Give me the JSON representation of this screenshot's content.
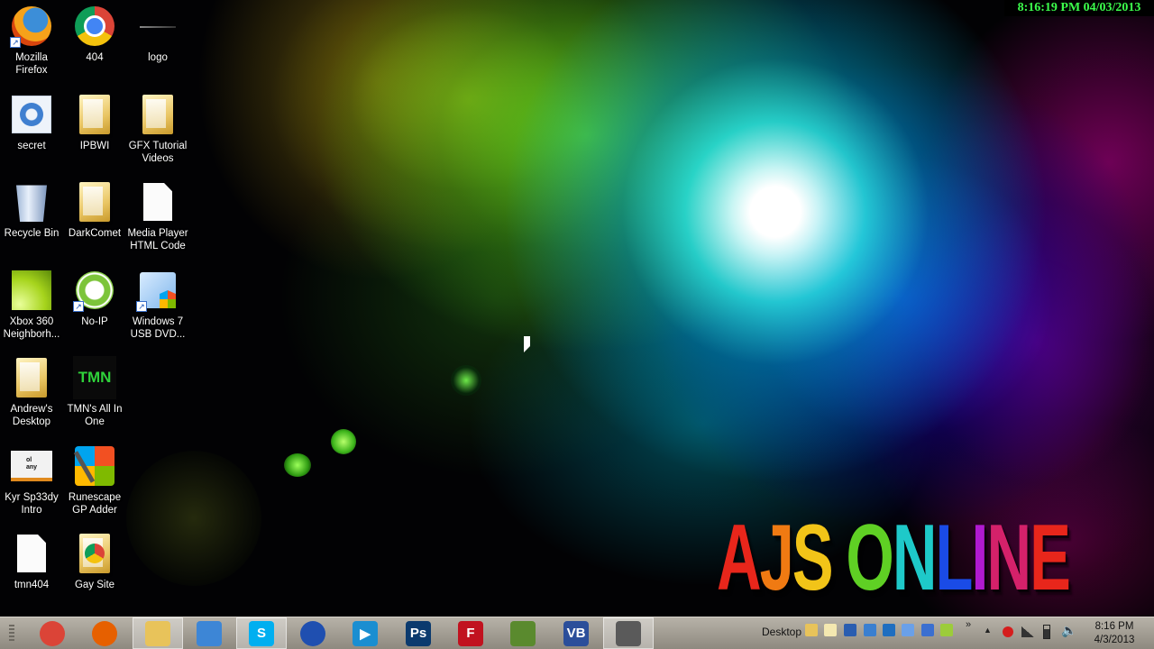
{
  "desktop_icons": [
    {
      "label": "Mozilla\nFirefox",
      "icon": "firefox-icon"
    },
    {
      "label": "404",
      "icon": "chrome-icon"
    },
    {
      "label": "logo",
      "icon": "logo-thumbnail-icon"
    },
    {
      "label": "secret",
      "icon": "settings-gear-icon"
    },
    {
      "label": "IPBWI",
      "icon": "folder-icon"
    },
    {
      "label": "GFX Tutorial\nVideos",
      "icon": "folder-icon"
    },
    {
      "label": "Recycle Bin",
      "icon": "recycle-bin-icon"
    },
    {
      "label": "DarkComet",
      "icon": "folder-icon"
    },
    {
      "label": "Media Player\nHTML Code",
      "icon": "document-icon"
    },
    {
      "label": "Xbox 360\nNeighborh...",
      "icon": "xbox-icon"
    },
    {
      "label": "No-IP",
      "icon": "noip-icon"
    },
    {
      "label": "Windows 7\nUSB DVD...",
      "icon": "windows-usb-icon"
    },
    {
      "label": "Andrew's\nDesktop",
      "icon": "folder-icon"
    },
    {
      "label": "TMN's All In\nOne",
      "icon": "tmn-icon"
    },
    {
      "label": "Kyr Sp33dy\nIntro",
      "icon": "video-thumbnail-icon"
    },
    {
      "label": "Runescape\nGP Adder",
      "icon": "runescape-tool-icon"
    },
    {
      "label": "tmn404",
      "icon": "document-icon"
    },
    {
      "label": "Gay Site",
      "icon": "chrome-folder-icon"
    }
  ],
  "tmn_logo_text": "TMN",
  "kyr_thumb_text": "ol\nany",
  "overlay_clock": "8:16:19 PM 04/03/2013",
  "brand_text": [
    "A",
    "J",
    "S",
    " ",
    "O",
    "N",
    "L",
    "I",
    "N",
    "E"
  ],
  "brand_colors": [
    "#e8261b",
    "#f07a12",
    "#f2c418",
    "#ffffff",
    "#5fd024",
    "#1ec9c9",
    "#1a4be6",
    "#b01ad0",
    "#d4216a",
    "#e8261b"
  ],
  "taskbar": {
    "apps": [
      {
        "name": "chrome-icon",
        "color": "#db4437",
        "glyph": ""
      },
      {
        "name": "firefox-icon",
        "color": "#e66000",
        "glyph": ""
      },
      {
        "name": "file-explorer-icon",
        "color": "#e8c35a",
        "glyph": ""
      },
      {
        "name": "folder-search-icon",
        "color": "#3d86d6",
        "glyph": ""
      },
      {
        "name": "skype-icon",
        "color": "#00aff0",
        "glyph": "S"
      },
      {
        "name": "browser-globe-icon",
        "color": "#1f4fb0",
        "glyph": ""
      },
      {
        "name": "media-player-icon",
        "color": "#1a8ed1",
        "glyph": "▶"
      },
      {
        "name": "photoshop-icon",
        "color": "#0b3a6e",
        "glyph": "Ps"
      },
      {
        "name": "filezilla-icon",
        "color": "#c1121f",
        "glyph": "F"
      },
      {
        "name": "minecraft-icon",
        "color": "#5a8a2e",
        "glyph": ""
      },
      {
        "name": "vb-editor-icon",
        "color": "#2b4e9a",
        "glyph": "VB"
      },
      {
        "name": "video-camera-icon",
        "color": "#5a5a5a",
        "glyph": ""
      }
    ],
    "active_indices": [
      2,
      4,
      11
    ],
    "desktop_label": "Desktop",
    "time": "8:16 PM",
    "date": "4/3/2013"
  }
}
